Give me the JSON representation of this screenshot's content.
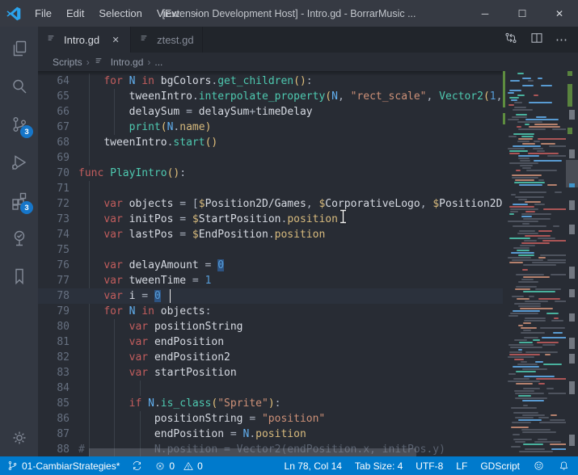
{
  "window": {
    "title": "[Extension Development Host] - Intro.gd - BorrarMusic ...",
    "menus": [
      "File",
      "Edit",
      "Selection",
      "View",
      "⋯"
    ],
    "controls": [
      {
        "name": "minimize",
        "glyph": "─"
      },
      {
        "name": "maximize",
        "glyph": "☐"
      },
      {
        "name": "close",
        "glyph": "✕"
      }
    ]
  },
  "activity_bar": {
    "items": [
      {
        "name": "explorer"
      },
      {
        "name": "search"
      },
      {
        "name": "source-control",
        "badge": "3"
      },
      {
        "name": "run-debug"
      },
      {
        "name": "extensions",
        "badge": "3"
      },
      {
        "name": "todo-tree"
      },
      {
        "name": "bookmarks"
      }
    ],
    "bottom_items": [
      {
        "name": "settings"
      }
    ]
  },
  "editor_tabs": {
    "tabs": [
      {
        "label": "Intro.gd",
        "active": true,
        "close_glyph": "✕"
      },
      {
        "label": "ztest.gd",
        "active": false
      }
    ],
    "actions": [
      {
        "name": "open-changes"
      },
      {
        "name": "split-editor"
      },
      {
        "name": "more-actions",
        "glyph": "⋯"
      }
    ]
  },
  "breadcrumbs": {
    "items": [
      "Scripts",
      "Intro.gd",
      "..."
    ]
  },
  "editor": {
    "language": "GDScript",
    "first_line": 64,
    "current_line": 78,
    "lines": [
      {
        "n": 64,
        "t": [
          [
            "    ",
            ""
          ],
          [
            "for",
            "kw"
          ],
          [
            " ",
            ""
          ],
          [
            "N",
            "cls"
          ],
          [
            " ",
            ""
          ],
          [
            "in",
            "kw"
          ],
          [
            " ",
            ""
          ],
          [
            "bgColors",
            "var"
          ],
          [
            ".",
            ""
          ],
          [
            "get_children",
            "fn"
          ],
          [
            "(",
            "brk"
          ],
          [
            ")",
            "brk"
          ],
          [
            ":",
            ""
          ]
        ]
      },
      {
        "n": 65,
        "t": [
          [
            "        ",
            ""
          ],
          [
            "tweenIntro",
            "var"
          ],
          [
            ".",
            ""
          ],
          [
            "interpolate_property",
            "fn"
          ],
          [
            "(",
            "brk"
          ],
          [
            "N",
            "cls"
          ],
          [
            ", ",
            ""
          ],
          [
            "\"rect_scale\"",
            "str"
          ],
          [
            ", ",
            ""
          ],
          [
            "Vector2",
            "fn"
          ],
          [
            "(",
            "brk"
          ],
          [
            "1",
            "num"
          ],
          [
            ",",
            ""
          ]
        ]
      },
      {
        "n": 66,
        "t": [
          [
            "        ",
            ""
          ],
          [
            "delaySum",
            "var"
          ],
          [
            " = ",
            ""
          ],
          [
            "delaySum",
            "var"
          ],
          [
            "+",
            ""
          ],
          [
            "timeDelay",
            "var"
          ]
        ]
      },
      {
        "n": 67,
        "t": [
          [
            "        ",
            ""
          ],
          [
            "print",
            "fn"
          ],
          [
            "(",
            "brk"
          ],
          [
            "N",
            "cls"
          ],
          [
            ".",
            ""
          ],
          [
            "name",
            "prop"
          ],
          [
            ")",
            "brk"
          ]
        ]
      },
      {
        "n": 68,
        "t": [
          [
            "    ",
            ""
          ],
          [
            "tweenIntro",
            "var"
          ],
          [
            ".",
            ""
          ],
          [
            "start",
            "fn"
          ],
          [
            "(",
            "brk"
          ],
          [
            ")",
            "brk"
          ]
        ]
      },
      {
        "n": 69,
        "t": []
      },
      {
        "n": 70,
        "t": [
          [
            "func",
            "kw"
          ],
          [
            " ",
            ""
          ],
          [
            "PlayIntro",
            "fn"
          ],
          [
            "(",
            "brk"
          ],
          [
            ")",
            "brk"
          ],
          [
            ":",
            ""
          ]
        ]
      },
      {
        "n": 71,
        "t": []
      },
      {
        "n": 72,
        "t": [
          [
            "    ",
            ""
          ],
          [
            "var",
            "kw"
          ],
          [
            " ",
            ""
          ],
          [
            "objects",
            "var"
          ],
          [
            " = [",
            ""
          ],
          [
            "$",
            "dollar"
          ],
          [
            "Position2D/Games",
            "var"
          ],
          [
            ", ",
            ""
          ],
          [
            "$",
            "dollar"
          ],
          [
            "CorporativeLogo",
            "var"
          ],
          [
            ", ",
            ""
          ],
          [
            "$",
            "dollar"
          ],
          [
            "Position2D",
            "var"
          ]
        ]
      },
      {
        "n": 73,
        "t": [
          [
            "    ",
            ""
          ],
          [
            "var",
            "kw"
          ],
          [
            " ",
            ""
          ],
          [
            "initPos",
            "var"
          ],
          [
            " = ",
            ""
          ],
          [
            "$",
            "dollar"
          ],
          [
            "StartPosition",
            "var"
          ],
          [
            ".",
            ""
          ],
          [
            "position",
            "prop"
          ]
        ]
      },
      {
        "n": 74,
        "t": [
          [
            "    ",
            ""
          ],
          [
            "var",
            "kw"
          ],
          [
            " ",
            ""
          ],
          [
            "lastPos",
            "var"
          ],
          [
            " = ",
            ""
          ],
          [
            "$",
            "dollar"
          ],
          [
            "EndPosition",
            "var"
          ],
          [
            ".",
            ""
          ],
          [
            "position",
            "prop"
          ]
        ]
      },
      {
        "n": 75,
        "t": []
      },
      {
        "n": 76,
        "t": [
          [
            "    ",
            ""
          ],
          [
            "var",
            "kw"
          ],
          [
            " ",
            ""
          ],
          [
            "delayAmount",
            "var"
          ],
          [
            " = ",
            ""
          ],
          [
            "0",
            "num sel"
          ]
        ]
      },
      {
        "n": 77,
        "t": [
          [
            "    ",
            ""
          ],
          [
            "var",
            "kw"
          ],
          [
            " ",
            ""
          ],
          [
            "tweenTime",
            "var"
          ],
          [
            " = ",
            ""
          ],
          [
            "1",
            "num"
          ]
        ]
      },
      {
        "n": 78,
        "t": [
          [
            "    ",
            ""
          ],
          [
            "var",
            "kw"
          ],
          [
            " ",
            ""
          ],
          [
            "i",
            "var"
          ],
          [
            " = ",
            ""
          ],
          [
            "0",
            "num sel"
          ]
        ]
      },
      {
        "n": 79,
        "t": [
          [
            "    ",
            ""
          ],
          [
            "for",
            "kw"
          ],
          [
            " ",
            ""
          ],
          [
            "N",
            "cls"
          ],
          [
            " ",
            ""
          ],
          [
            "in",
            "kw"
          ],
          [
            " ",
            ""
          ],
          [
            "objects",
            "var"
          ],
          [
            ":",
            ""
          ]
        ]
      },
      {
        "n": 80,
        "t": [
          [
            "        ",
            ""
          ],
          [
            "var",
            "kw"
          ],
          [
            " ",
            ""
          ],
          [
            "positionString",
            "var"
          ]
        ]
      },
      {
        "n": 81,
        "t": [
          [
            "        ",
            ""
          ],
          [
            "var",
            "kw"
          ],
          [
            " ",
            ""
          ],
          [
            "endPosition",
            "var"
          ]
        ]
      },
      {
        "n": 82,
        "t": [
          [
            "        ",
            ""
          ],
          [
            "var",
            "kw"
          ],
          [
            " ",
            ""
          ],
          [
            "endPosition2",
            "var"
          ]
        ]
      },
      {
        "n": 83,
        "t": [
          [
            "        ",
            ""
          ],
          [
            "var",
            "kw"
          ],
          [
            " ",
            ""
          ],
          [
            "startPosition",
            "var"
          ]
        ]
      },
      {
        "n": 84,
        "t": []
      },
      {
        "n": 85,
        "t": [
          [
            "        ",
            ""
          ],
          [
            "if",
            "kw"
          ],
          [
            " ",
            ""
          ],
          [
            "N",
            "cls"
          ],
          [
            ".",
            ""
          ],
          [
            "is_class",
            "fn"
          ],
          [
            "(",
            "brk"
          ],
          [
            "\"Sprite\"",
            "str"
          ],
          [
            ")",
            "brk"
          ],
          [
            ":",
            ""
          ]
        ]
      },
      {
        "n": 86,
        "t": [
          [
            "            ",
            ""
          ],
          [
            "positionString",
            "var"
          ],
          [
            " = ",
            ""
          ],
          [
            "\"position\"",
            "str"
          ]
        ]
      },
      {
        "n": 87,
        "t": [
          [
            "            ",
            ""
          ],
          [
            "endPosition",
            "var"
          ],
          [
            " = ",
            ""
          ],
          [
            "N",
            "cls"
          ],
          [
            ".",
            ""
          ],
          [
            "position",
            "prop"
          ]
        ]
      },
      {
        "n": 88,
        "t": [
          [
            "#",
            "cmt"
          ],
          [
            "           ",
            ""
          ],
          [
            "N.position = Vector2(endPosition.x, initPos.y)",
            "cmt"
          ]
        ]
      }
    ]
  },
  "status_bar": {
    "left_items": [
      {
        "name": "branch",
        "label": "01-CambiarStrategies*"
      },
      {
        "name": "sync"
      },
      {
        "name": "problems",
        "errors": "0",
        "warnings": "0"
      }
    ],
    "right_items": [
      {
        "name": "cursor-position",
        "label": "Ln 78, Col 14"
      },
      {
        "name": "tab-size",
        "label": "Tab Size: 4"
      },
      {
        "name": "encoding",
        "label": "UTF-8"
      },
      {
        "name": "eol",
        "label": "LF"
      },
      {
        "name": "language-mode",
        "label": "GDScript"
      },
      {
        "name": "feedback"
      },
      {
        "name": "notifications"
      }
    ]
  },
  "theme": {
    "status_bar_bg": "#007ACC",
    "badge_bg": "#1676C9",
    "editor_bg": "#282C34",
    "keyword_color": "#C25D5D",
    "function_color": "#4EC9B0",
    "string_color": "#CE9178",
    "selection_highlight": "#2D5382",
    "git_added_green": "#5E8D3F"
  }
}
